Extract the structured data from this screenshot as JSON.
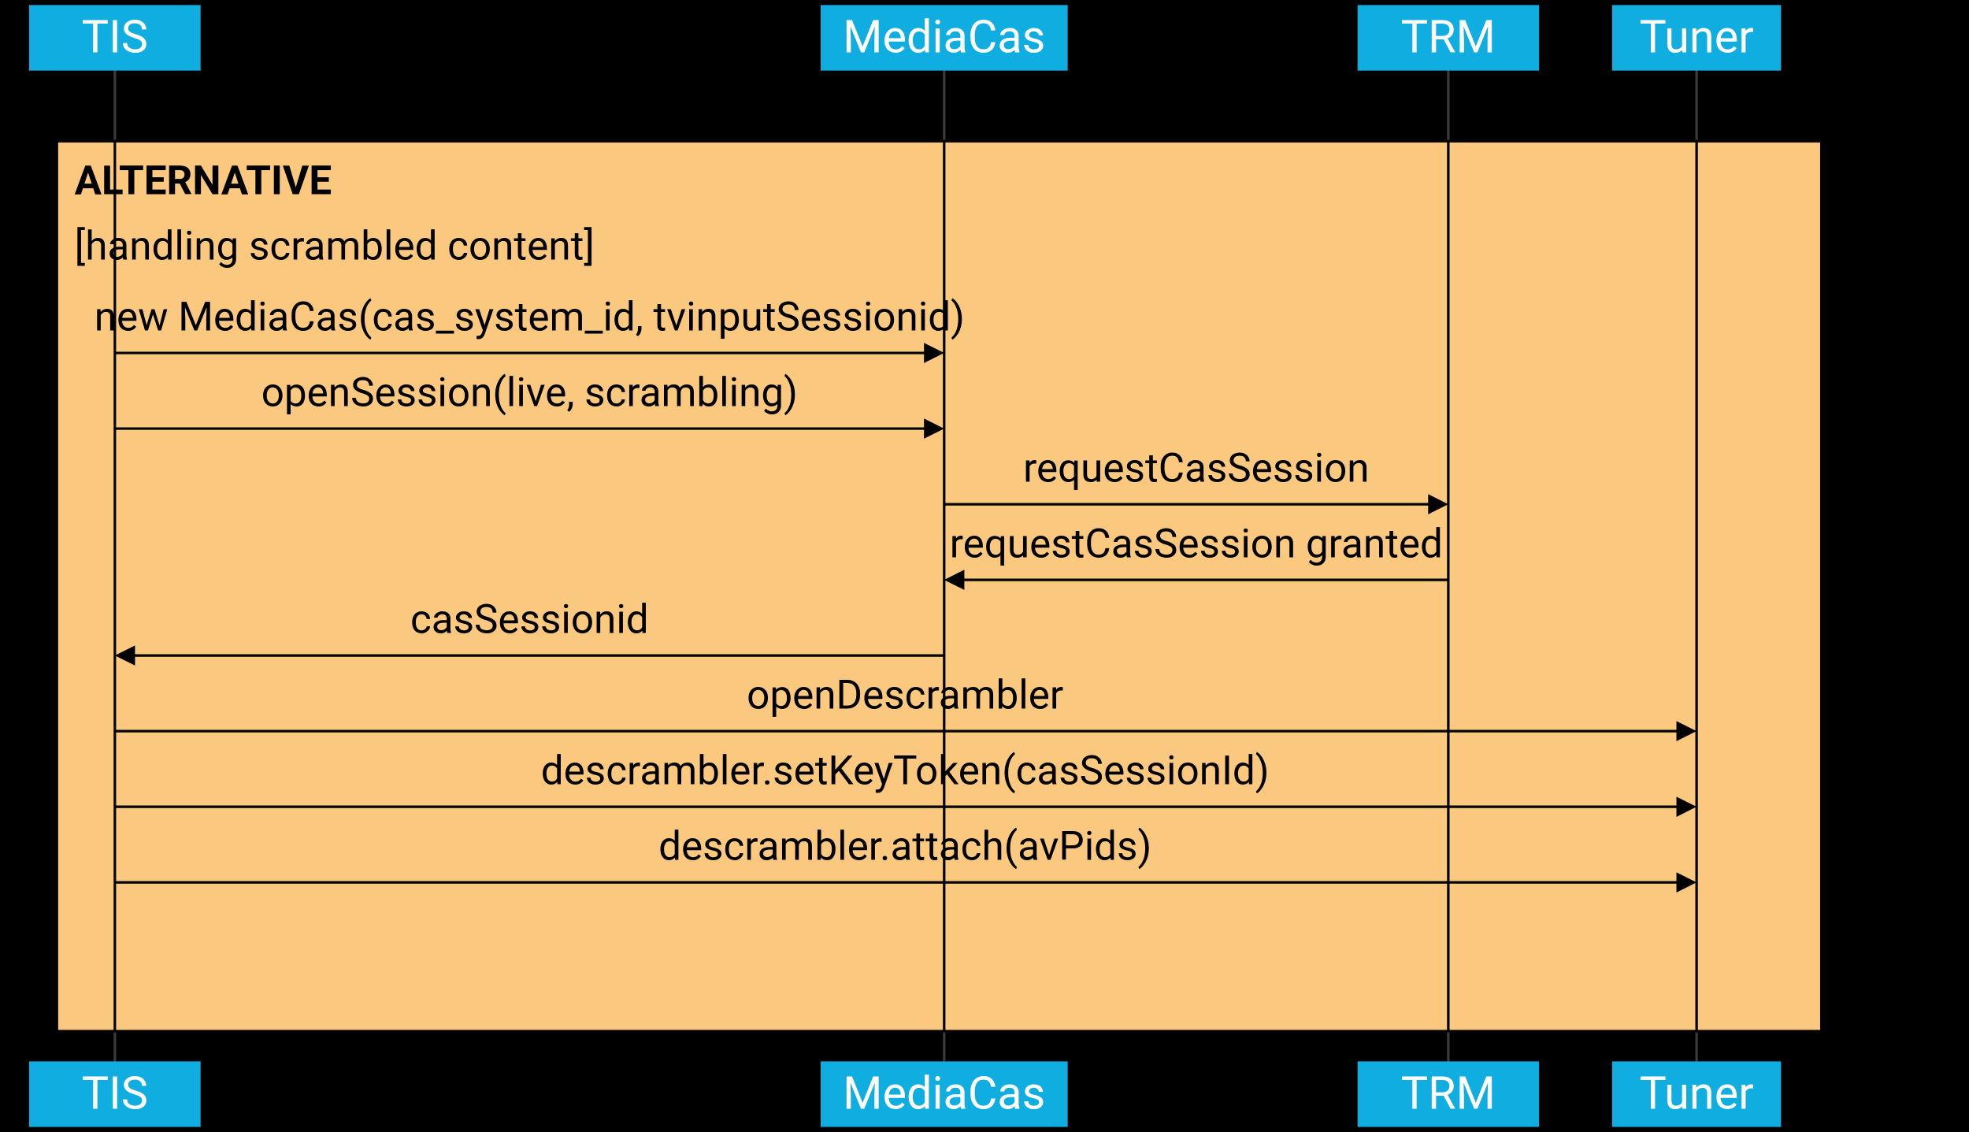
{
  "participants": {
    "tis": {
      "label": "TIS"
    },
    "mediacas": {
      "label": "MediaCas"
    },
    "trm": {
      "label": "TRM"
    },
    "tuner": {
      "label": "Tuner"
    }
  },
  "frame": {
    "title": "ALTERNATIVE",
    "guard": "[handling scrambled content]"
  },
  "messages": {
    "m1": {
      "from": "tis",
      "to": "mediacas",
      "label": "new MediaCas(cas_system_id, tvinputSessionid)"
    },
    "m2": {
      "from": "tis",
      "to": "mediacas",
      "label": "openSession(live, scrambling)"
    },
    "m3": {
      "from": "mediacas",
      "to": "trm",
      "label": "requestCasSession"
    },
    "m4": {
      "from": "trm",
      "to": "mediacas",
      "label": "requestCasSession granted"
    },
    "m5": {
      "from": "mediacas",
      "to": "tis",
      "label": "casSessionid"
    },
    "m6": {
      "from": "tis",
      "to": "tuner",
      "label": "openDescrambler"
    },
    "m7": {
      "from": "tis",
      "to": "tuner",
      "label": "descrambler.setKeyToken(casSessionId)"
    },
    "m8": {
      "from": "tis",
      "to": "tuner",
      "label": "descrambler.attach(avPids)"
    }
  }
}
